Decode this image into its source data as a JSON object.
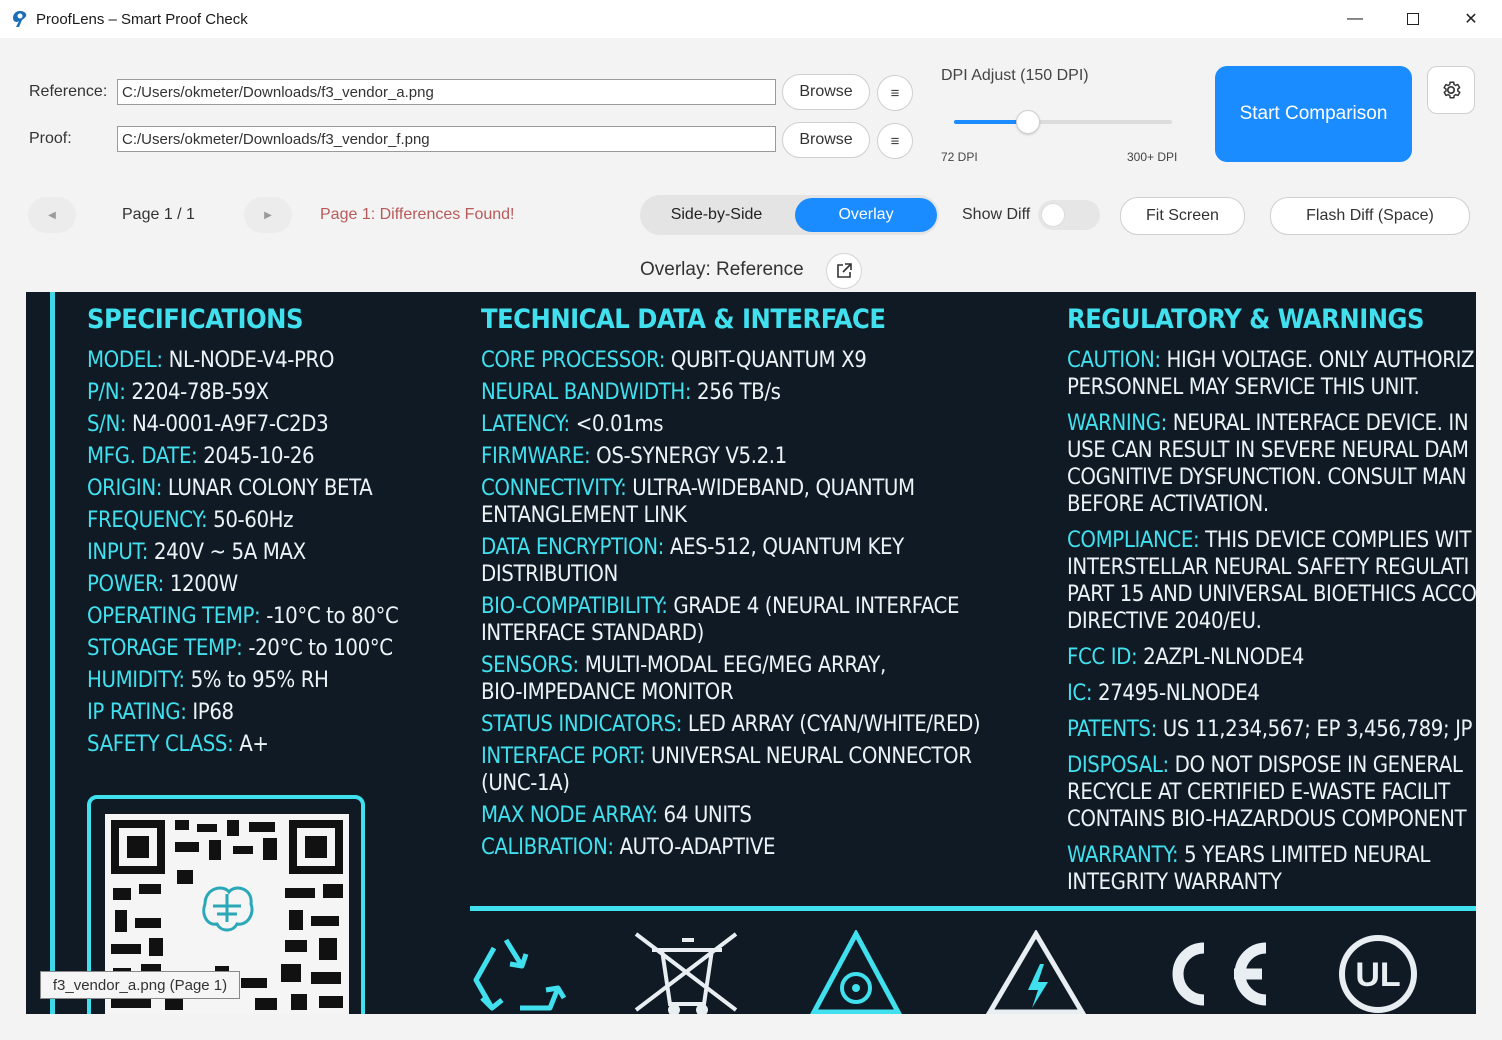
{
  "window": {
    "title": "ProofLens – Smart Proof Check",
    "controls": {
      "minimize": "—",
      "close": "✕"
    }
  },
  "files": {
    "reference_label": "Reference:",
    "reference_path": "C:/Users/okmeter/Downloads/f3_vendor_a.png",
    "proof_label": "Proof:",
    "proof_path": "C:/Users/okmeter/Downloads/f3_vendor_f.png",
    "browse_label": "Browse",
    "menu_glyph": "≡"
  },
  "dpi": {
    "label": "DPI Adjust (150 DPI)",
    "min_label": "72 DPI",
    "max_label": "300+ DPI",
    "value": 150,
    "min": 72,
    "max": 300
  },
  "actions": {
    "start_label": "Start Comparison"
  },
  "pager": {
    "prev": "◀",
    "next": "▶",
    "page_label": "Page 1 / 1",
    "status": "Page 1: Differences Found!"
  },
  "view_mode": {
    "options": [
      "Side-by-Side",
      "Overlay"
    ],
    "selected": "Overlay"
  },
  "show_diff": {
    "label": "Show Diff",
    "on": false
  },
  "buttons": {
    "fit": "Fit Screen",
    "flash": "Flash Diff (Space)"
  },
  "viewer": {
    "title": "Overlay: Reference",
    "tooltip": "f3_vendor_a.png (Page 1)"
  },
  "label_image": {
    "specs": {
      "heading": "SPECIFICATIONS",
      "rows": [
        [
          "MODEL:",
          " NL-NODE-V4-PRO"
        ],
        [
          "P/N:",
          " 2204-78B-59X"
        ],
        [
          "S/N:",
          " N4-0001-A9F7-C2D3"
        ],
        [
          "MFG. DATE:",
          " 2045-10-26"
        ],
        [
          "ORIGIN:",
          " LUNAR COLONY BETA"
        ],
        [
          "FREQUENCY:",
          " 50-60Hz"
        ],
        [
          "INPUT:",
          " 240V ~ 5A MAX"
        ],
        [
          "POWER:",
          " 1200W"
        ],
        [
          "OPERATING TEMP:",
          " -10°C to 80°C"
        ],
        [
          "STORAGE TEMP:",
          " -20°C to 100°C"
        ],
        [
          "HUMIDITY:",
          " 5% to 95% RH"
        ],
        [
          "IP RATING:",
          " IP68"
        ],
        [
          "SAFETY CLASS:",
          " A+"
        ]
      ]
    },
    "tech": {
      "heading": "TECHNICAL DATA & INTERFACE",
      "rows": [
        [
          "CORE PROCESSOR:",
          " QUBIT-QUANTUM X9"
        ],
        [
          "NEURAL BANDWIDTH:",
          " 256 TB/s"
        ],
        [
          "LATENCY:",
          " <0.01ms"
        ],
        [
          "FIRMWARE:",
          " OS-SYNERGY V5.2.1"
        ],
        [
          "CONNECTIVITY:",
          " ULTRA-WIDEBAND, QUANTUM"
        ],
        [
          "",
          "ENTANGLEMENT LINK"
        ],
        [
          "DATA ENCRYPTION:",
          " AES-512, QUANTUM KEY"
        ],
        [
          "",
          "DISTRIBUTION"
        ],
        [
          "BIO-COMPATIBILITY:",
          " GRADE 4 (NEURAL INTERFACE"
        ],
        [
          "",
          "INTERFACE STANDARD)"
        ],
        [
          "SENSORS:",
          " MULTI-MODAL EEG/MEG ARRAY,"
        ],
        [
          "",
          "BIO-IMPEDANCE MONITOR"
        ],
        [
          "STATUS INDICATORS:",
          " LED ARRAY (CYAN/WHITE/RED)"
        ],
        [
          "INTERFACE PORT:",
          " UNIVERSAL NEURAL CONNECTOR"
        ],
        [
          "",
          "(UNC-1A)"
        ],
        [
          "MAX NODE ARRAY:",
          " 64 UNITS"
        ],
        [
          "CALIBRATION:",
          " AUTO-ADAPTIVE"
        ]
      ]
    },
    "reg": {
      "heading": "REGULATORY & WARNINGS",
      "rows": [
        [
          "CAUTION:",
          " HIGH VOLTAGE. ONLY AUTHORIZ"
        ],
        [
          "",
          "PERSONNEL MAY SERVICE THIS UNIT."
        ],
        [
          "WARNING:",
          " NEURAL INTERFACE DEVICE. IN"
        ],
        [
          "",
          "USE CAN RESULT IN SEVERE NEURAL DAM"
        ],
        [
          "",
          "COGNITIVE DYSFUNCTION. CONSULT MAN"
        ],
        [
          "",
          "BEFORE ACTIVATION."
        ],
        [
          "COMPLIANCE:",
          " THIS DEVICE COMPLIES WIT"
        ],
        [
          "",
          "INTERSTELLAR NEURAL SAFETY REGULATI"
        ],
        [
          "",
          "PART 15 AND UNIVERSAL BIOETHICS ACCO"
        ],
        [
          "",
          "DIRECTIVE 2040/EU."
        ],
        [
          "FCC ID:",
          " 2AZPL-NLNODE4"
        ],
        [
          "IC:",
          " 27495-NLNODE4"
        ],
        [
          "PATENTS:",
          " US 11,234,567; EP 3,456,789; JP"
        ],
        [
          "DISPOSAL:",
          " DO NOT DISPOSE IN GENERAL"
        ],
        [
          "",
          "RECYCLE AT CERTIFIED E-WASTE FACILIT"
        ],
        [
          "",
          "CONTAINS BIO-HAZARDOUS COMPONENT"
        ],
        [
          "WARRANTY:",
          " 5 YEARS LIMITED NEURAL"
        ],
        [
          "",
          "INTEGRITY WARRANTY"
        ]
      ]
    },
    "symbols": [
      "recycle-icon",
      "weee-bin-icon",
      "biohazard-icon",
      "high-voltage-icon",
      "ce-mark-icon",
      "ul-mark-icon"
    ],
    "colors": {
      "background": "#101a25",
      "accent": "#41e0ee",
      "text": "#ecf3f7"
    }
  },
  "colors": {
    "primary": "#1a8cff",
    "alert": "#b85a5a"
  }
}
